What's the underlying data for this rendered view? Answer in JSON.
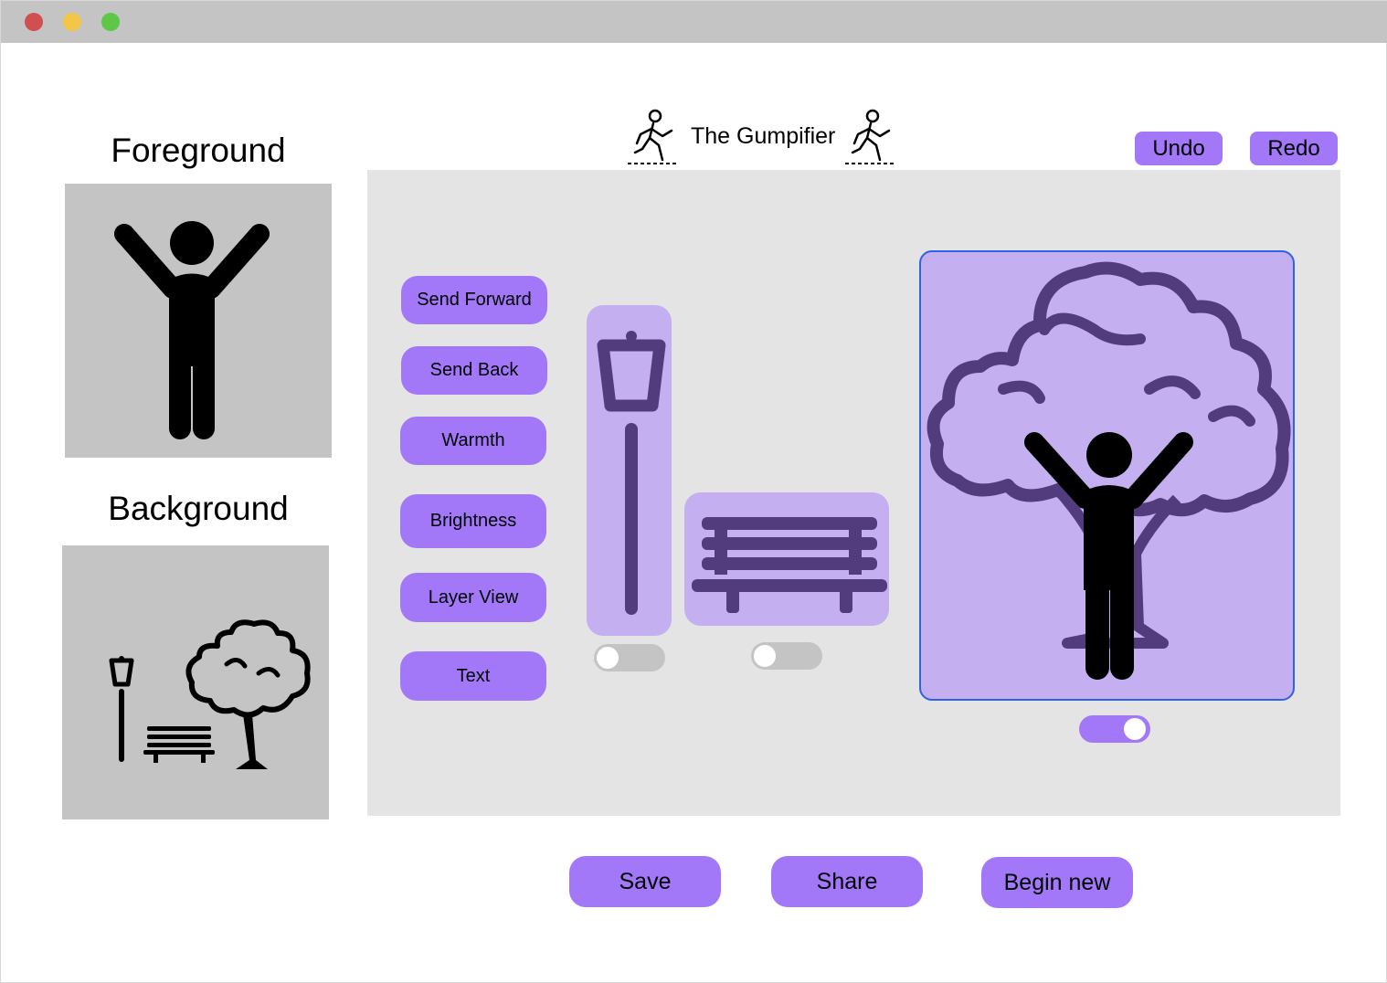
{
  "window": {
    "controls": [
      "close",
      "minimize",
      "maximize"
    ],
    "colors": {
      "close": "#d05050",
      "minimize": "#f3c646",
      "maximize": "#5ec747"
    }
  },
  "sidebar": {
    "foreground_label": "Foreground",
    "foreground_icon": "person-arms-up-icon",
    "background_label": "Background",
    "background_icons": [
      "street-lamp-icon",
      "bench-icon",
      "tree-icon"
    ]
  },
  "header": {
    "title": "The Gumpifier",
    "title_icon": "running-man-icon",
    "undo_label": "Undo",
    "redo_label": "Redo"
  },
  "tools": [
    {
      "label": "Send Forward"
    },
    {
      "label": "Send Back"
    },
    {
      "label": "Warmth"
    },
    {
      "label": "Brightness"
    },
    {
      "label": "Layer View"
    },
    {
      "label": "Text"
    }
  ],
  "layers": [
    {
      "icon": "street-lamp-icon",
      "visible": false
    },
    {
      "icon": "bench-icon",
      "visible": false
    },
    {
      "icon": "tree-person-icon",
      "visible": true,
      "selected": true
    }
  ],
  "footer": {
    "save_label": "Save",
    "share_label": "Share",
    "begin_new_label": "Begin new"
  },
  "colors": {
    "accent": "#a278f8",
    "layer_fill": "#c4aff0",
    "layer_icon": "#523c7e",
    "selection": "#2f63e0",
    "panel": "#c4c4c4",
    "canvas": "#e4e4e4"
  }
}
